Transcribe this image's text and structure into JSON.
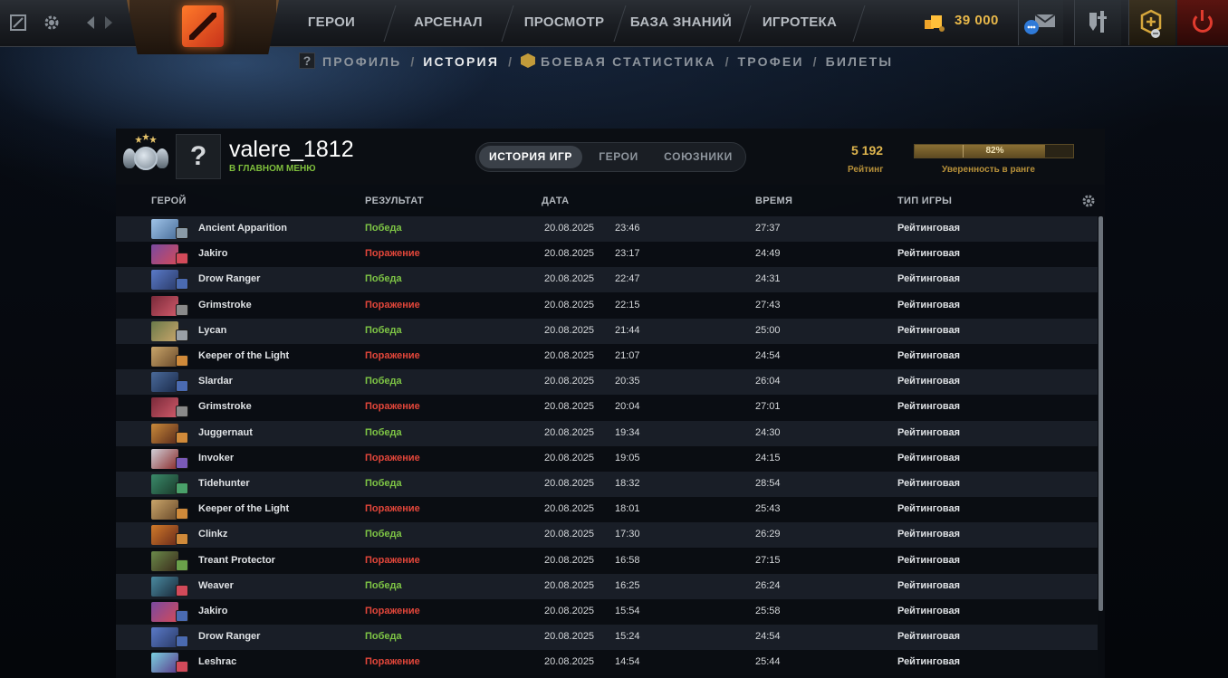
{
  "topbar": {
    "nav": [
      "ГЕРОИ",
      "АРСЕНАЛ",
      "ПРОСМОТР",
      "БАЗА ЗНАНИЙ",
      "ИГРОТЕКА"
    ],
    "currency": "39 000"
  },
  "subnav": {
    "profile": "ПРОФИЛЬ",
    "history": "ИСТОРИЯ",
    "stats": "БОЕВАЯ СТАТИСТИКА",
    "trophies": "ТРОФЕИ",
    "tickets": "БИЛЕТЫ",
    "sep": "/",
    "q": "?"
  },
  "profile": {
    "avatar": "?",
    "username": "valere_1812",
    "status": "В ГЛАВНОМ МЕНЮ",
    "tabs": [
      "ИСТОРИЯ ИГР",
      "ГЕРОИ",
      "СОЮЗНИКИ"
    ],
    "rating_value": "5 192",
    "rating_label": "Рейтинг",
    "confidence_pct": 82,
    "confidence_text": "82%",
    "confidence_label": "Уверенность в ранге"
  },
  "table": {
    "headers": [
      "ГЕРОЙ",
      "РЕЗУЛЬТАТ",
      "ДАТА",
      "ВРЕМЯ",
      "ТИП ИГРЫ"
    ],
    "rows": [
      {
        "hero": "Ancient Apparition",
        "result": "Победа",
        "win": true,
        "date": "20.08.2025",
        "time": "23:46",
        "duration": "27:37",
        "type": "Рейтинговая"
      },
      {
        "hero": "Jakiro",
        "result": "Поражение",
        "win": false,
        "date": "20.08.2025",
        "time": "23:17",
        "duration": "24:49",
        "type": "Рейтинговая"
      },
      {
        "hero": "Drow Ranger",
        "result": "Победа",
        "win": true,
        "date": "20.08.2025",
        "time": "22:47",
        "duration": "24:31",
        "type": "Рейтинговая"
      },
      {
        "hero": "Grimstroke",
        "result": "Поражение",
        "win": false,
        "date": "20.08.2025",
        "time": "22:15",
        "duration": "27:43",
        "type": "Рейтинговая"
      },
      {
        "hero": "Lycan",
        "result": "Победа",
        "win": true,
        "date": "20.08.2025",
        "time": "21:44",
        "duration": "25:00",
        "type": "Рейтинговая"
      },
      {
        "hero": "Keeper of the Light",
        "result": "Поражение",
        "win": false,
        "date": "20.08.2025",
        "time": "21:07",
        "duration": "24:54",
        "type": "Рейтинговая"
      },
      {
        "hero": "Slardar",
        "result": "Победа",
        "win": true,
        "date": "20.08.2025",
        "time": "20:35",
        "duration": "26:04",
        "type": "Рейтинговая"
      },
      {
        "hero": "Grimstroke",
        "result": "Поражение",
        "win": false,
        "date": "20.08.2025",
        "time": "20:04",
        "duration": "27:01",
        "type": "Рейтинговая"
      },
      {
        "hero": "Juggernaut",
        "result": "Победа",
        "win": true,
        "date": "20.08.2025",
        "time": "19:34",
        "duration": "24:30",
        "type": "Рейтинговая"
      },
      {
        "hero": "Invoker",
        "result": "Поражение",
        "win": false,
        "date": "20.08.2025",
        "time": "19:05",
        "duration": "24:15",
        "type": "Рейтинговая"
      },
      {
        "hero": "Tidehunter",
        "result": "Победа",
        "win": true,
        "date": "20.08.2025",
        "time": "18:32",
        "duration": "28:54",
        "type": "Рейтинговая"
      },
      {
        "hero": "Keeper of the Light",
        "result": "Поражение",
        "win": false,
        "date": "20.08.2025",
        "time": "18:01",
        "duration": "25:43",
        "type": "Рейтинговая"
      },
      {
        "hero": "Clinkz",
        "result": "Победа",
        "win": true,
        "date": "20.08.2025",
        "time": "17:30",
        "duration": "26:29",
        "type": "Рейтинговая"
      },
      {
        "hero": "Treant Protector",
        "result": "Поражение",
        "win": false,
        "date": "20.08.2025",
        "time": "16:58",
        "duration": "27:15",
        "type": "Рейтинговая"
      },
      {
        "hero": "Weaver",
        "result": "Победа",
        "win": true,
        "date": "20.08.2025",
        "time": "16:25",
        "duration": "26:24",
        "type": "Рейтинговая"
      },
      {
        "hero": "Jakiro",
        "result": "Поражение",
        "win": false,
        "date": "20.08.2025",
        "time": "15:54",
        "duration": "25:58",
        "type": "Рейтинговая"
      },
      {
        "hero": "Drow Ranger",
        "result": "Победа",
        "win": true,
        "date": "20.08.2025",
        "time": "15:24",
        "duration": "24:54",
        "type": "Рейтинговая"
      },
      {
        "hero": "Leshrac",
        "result": "Поражение",
        "win": false,
        "date": "20.08.2025",
        "time": "14:54",
        "duration": "25:44",
        "type": "Рейтинговая"
      }
    ]
  },
  "colors": {
    "win": "#7ec545",
    "loss": "#e2463a",
    "gold": "#e0b64e",
    "accent_orange": "#ff7a2a"
  },
  "icons": {
    "top_left": [
      "dota-plus-icon",
      "gear-icon",
      "back-arrow-icon",
      "forward-arrow-icon"
    ],
    "top_right": [
      "shards-coin-icon",
      "chat-icon",
      "armory-icon",
      "dota-plus-hex-icon",
      "power-icon"
    ]
  }
}
